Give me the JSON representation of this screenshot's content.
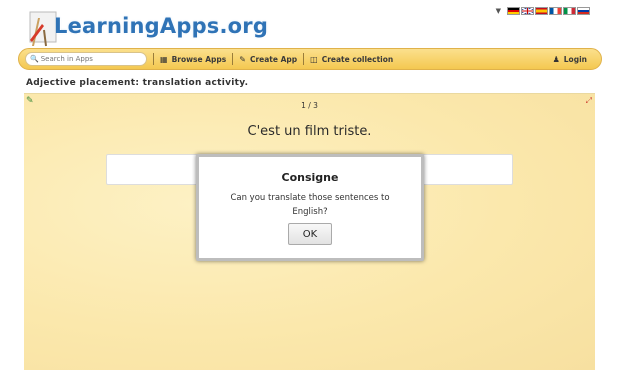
{
  "header": {
    "logo_text": "LearningApps.org",
    "languages": [
      "de",
      "en",
      "es",
      "fr",
      "it",
      "ru"
    ]
  },
  "nav": {
    "search_placeholder": "Search in Apps",
    "browse": "Browse Apps",
    "create": "Create App",
    "collection": "Create collection",
    "login": "Login"
  },
  "page": {
    "title": "Adjective placement: translation activity."
  },
  "activity": {
    "counter": "1 / 3",
    "sentence": "C'est un film triste."
  },
  "dialog": {
    "title": "Consigne",
    "message": "Can you translate those sentences to English?",
    "ok": "OK"
  },
  "colors": {
    "logo": "#2f73b6",
    "nav_bg": "#f4c850",
    "activity_bg": "#fbe8ac"
  }
}
